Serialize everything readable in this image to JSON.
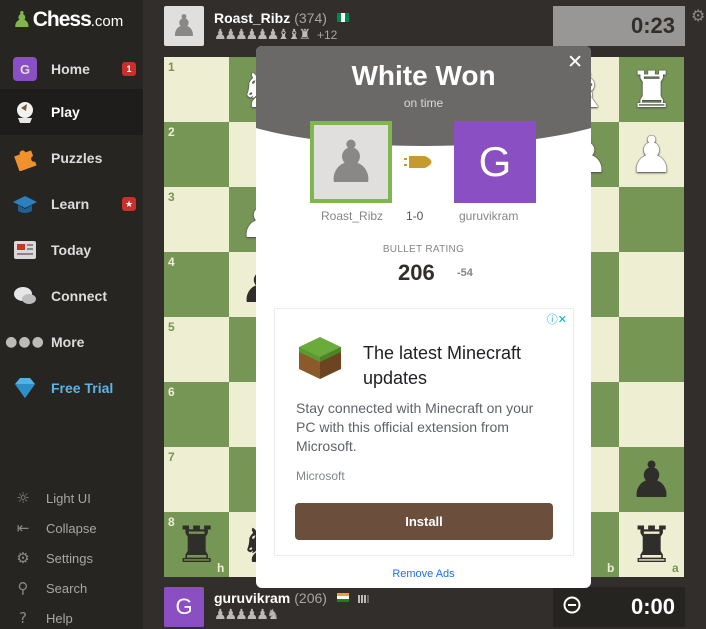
{
  "sidebar": {
    "logo_text": "Chess",
    "logo_suffix": ".com",
    "items": [
      {
        "label": "Home",
        "icon": "home-avatar-icon",
        "avatar_letter": "G",
        "badge": "1"
      },
      {
        "label": "Play",
        "icon": "play-hand-icon"
      },
      {
        "label": "Puzzles",
        "icon": "puzzle-icon"
      },
      {
        "label": "Learn",
        "icon": "graduation-cap-icon",
        "badge": "★"
      },
      {
        "label": "Today",
        "icon": "newspaper-icon"
      },
      {
        "label": "Connect",
        "icon": "chat-bubble-icon"
      },
      {
        "label": "More",
        "icon": "more-dots-icon"
      },
      {
        "label": "Free Trial",
        "icon": "diamond-icon"
      }
    ],
    "footer": [
      {
        "label": "Light UI",
        "icon": "sun-icon"
      },
      {
        "label": "Collapse",
        "icon": "collapse-arrow-icon"
      },
      {
        "label": "Settings",
        "icon": "gear-icon"
      },
      {
        "label": "Search",
        "icon": "search-icon"
      },
      {
        "label": "Help",
        "icon": "help-icon"
      }
    ]
  },
  "top_player": {
    "name": "Roast_Ribz",
    "rating": "(374)",
    "captures": "♟♟♟♟♟♟♝♝♜",
    "plus": "+12",
    "clock": "0:23"
  },
  "bottom_player": {
    "avatar_letter": "G",
    "name": "guruvikram",
    "rating": "(206)",
    "captures": "♟♟♟♟♟♞",
    "clock": "0:00"
  },
  "board": {
    "ranks": [
      "1",
      "2",
      "3",
      "4",
      "5",
      "6",
      "7",
      "8"
    ],
    "files_visible": [
      "h",
      "b",
      "a"
    ],
    "light_color": "#eeeed2",
    "dark_color": "#769656"
  },
  "modal": {
    "title": "White Won",
    "subtitle": "on time",
    "close": "✕",
    "winner": "Roast_Ribz",
    "loser": "guruvikram",
    "loser_avatar_letter": "G",
    "score": "1-0",
    "rating_label": "BULLET RATING",
    "rating_value": "206",
    "rating_delta": "-54",
    "remove_ads": "Remove Ads"
  },
  "ad": {
    "headline": "The latest Minecraft updates",
    "body": "Stay connected with Minecraft on your PC with this official extension from Microsoft.",
    "source": "Microsoft",
    "button": "Install",
    "info_icon": "ⓘ✕"
  }
}
